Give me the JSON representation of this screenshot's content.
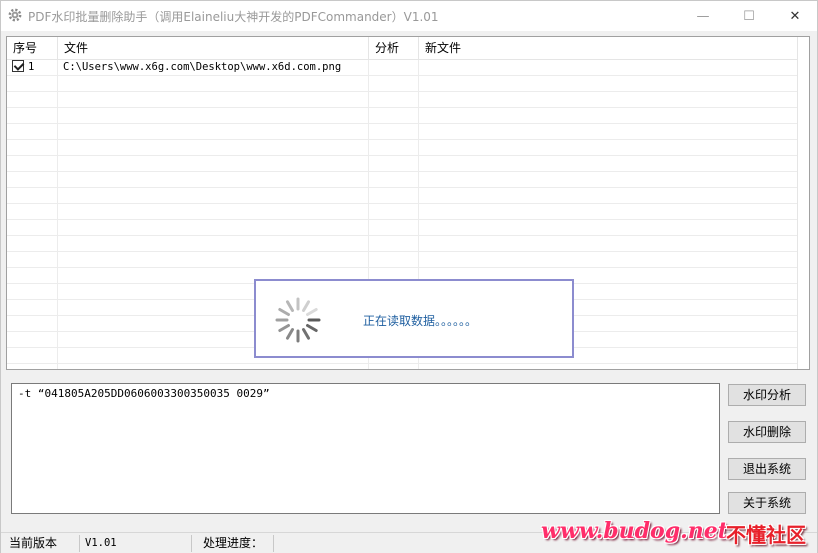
{
  "window": {
    "title": "PDF水印批量删除助手（调用Elaineliu大神开发的PDFCommander）V1.01",
    "minimize_glyph": "—",
    "maximize_glyph": "☐",
    "close_glyph": "✕",
    "icon": "gear-icon"
  },
  "table": {
    "columns": [
      "序号",
      "文件",
      "分析",
      "新文件"
    ],
    "rows": [
      {
        "checked": true,
        "seq": "1",
        "file": "C:\\Users\\www.x6g.com\\Desktop\\www.x6d.com.png",
        "analysis": "",
        "new_file": ""
      }
    ]
  },
  "loading": {
    "text": "正在读取数据。。。。。。",
    "icon": "spinner-icon",
    "accent_color": "#1f5fa0",
    "border_color": "#8c8ccf"
  },
  "command": {
    "value": "-t “041805A205DD0606003300350035 0029”"
  },
  "buttons": {
    "analyze": "水印分析",
    "delete": "水印删除",
    "exit": "退出系统",
    "about": "关于系统"
  },
  "statusbar": {
    "version_label": "当前版本",
    "version_value": "V1.01",
    "progress_label": "处理进度："
  },
  "watermark": {
    "url": "www.budog.net",
    "site_name": "不懂社区"
  }
}
